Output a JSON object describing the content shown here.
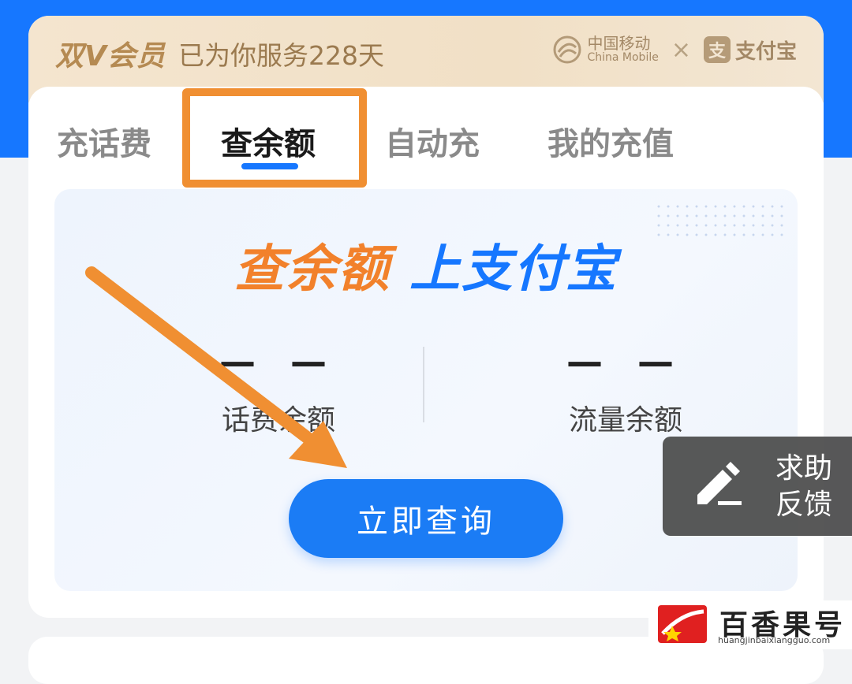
{
  "member": {
    "vip_title": "双V会员",
    "days_text": "已为你服务228天",
    "partner_cm_cn": "中国移动",
    "partner_cm_en": "China Mobile",
    "times": "×",
    "alipay_glyph": "支",
    "alipay_text": "支付宝"
  },
  "tabs": [
    {
      "label": "充话费",
      "active": false
    },
    {
      "label": "查余额",
      "active": true
    },
    {
      "label": "自动充",
      "active": false
    },
    {
      "label": "我的充值",
      "active": false
    }
  ],
  "panel": {
    "slogan_orange": "查余额",
    "slogan_blue": "上支付宝",
    "balance_value": "— —",
    "balance_label": "话费余额",
    "data_value": "— —",
    "data_label": "流量余额",
    "query_button": "立即查询"
  },
  "feedback": {
    "line1": "求助",
    "line2": "反馈",
    "icon": "pencil-icon"
  },
  "watermark": {
    "cn": "百香果号",
    "en": "huangjinbaixiangguo.com"
  },
  "colors": {
    "brand_blue": "#1677ff",
    "annotation_orange": "#f08f32",
    "slogan_orange": "#f2812b",
    "gold_text": "#b58a52"
  }
}
